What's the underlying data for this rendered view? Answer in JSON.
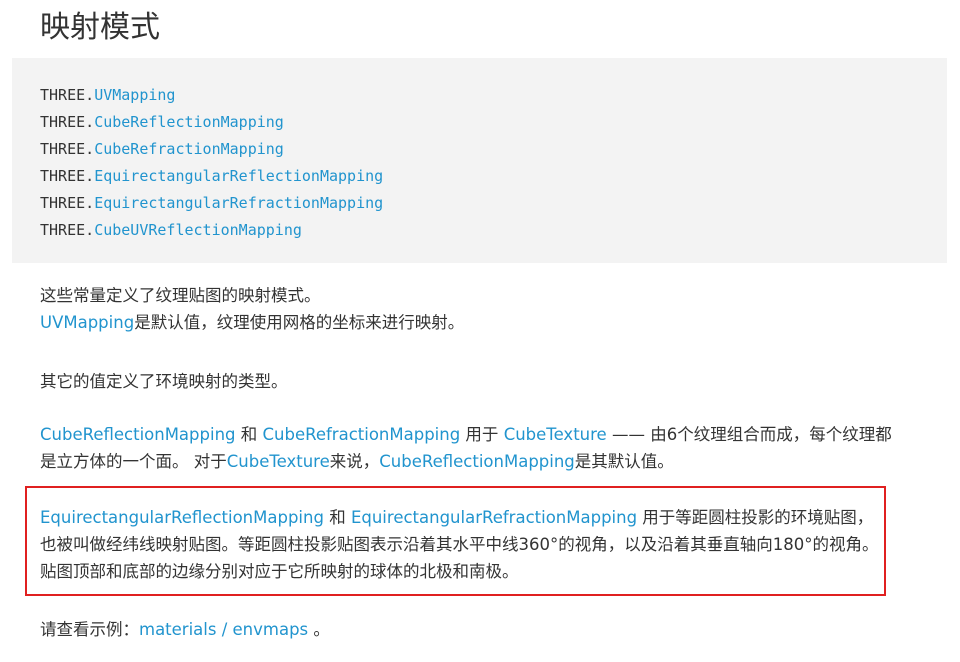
{
  "page": {
    "title": "映射模式"
  },
  "code_block": {
    "prefix": "THREE.",
    "constants": [
      "UVMapping",
      "CubeReflectionMapping",
      "CubeRefractionMapping",
      "EquirectangularReflectionMapping",
      "EquirectangularRefractionMapping",
      "CubeUVReflectionMapping"
    ]
  },
  "desc": {
    "intro_line": "这些常量定义了纹理贴图的映射模式。",
    "default_link": "UVMapping",
    "default_text": "是默认值，纹理使用网格的坐标来进行映射。",
    "env_intro": "其它的值定义了环境映射的类型。",
    "cube": {
      "link1": "CubeReflectionMapping",
      "and": " 和 ",
      "link2": "CubeRefractionMapping",
      "used_for": " 用于 ",
      "link3": "CubeTexture",
      "text1": " —— 由6个纹理组合而成，每个纹理都是立方体的一个面。 对于",
      "link4": "CubeTexture",
      "text2": "来说，",
      "link5": "CubeReflectionMapping",
      "text3": "是其默认值。"
    },
    "equirect": {
      "link1": "EquirectangularReflectionMapping",
      "and": " 和 ",
      "link2": "EquirectangularRefractionMapping",
      "text": " 用于等距圆柱投影的环境贴图，也被叫做经纬线映射贴图。等距圆柱投影贴图表示沿着其水平中线360°的视角，以及沿着其垂直轴向180°的视角。贴图顶部和底部的边缘分别对应于它所映射的球体的北极和南极。"
    },
    "example": {
      "label": "请查看示例：",
      "link": "materials / envmaps",
      "suffix": " 。"
    }
  },
  "colors": {
    "link": "#2194ce",
    "text": "#333333",
    "code_bg": "#f3f3f3",
    "highlight_border": "#e02020"
  }
}
